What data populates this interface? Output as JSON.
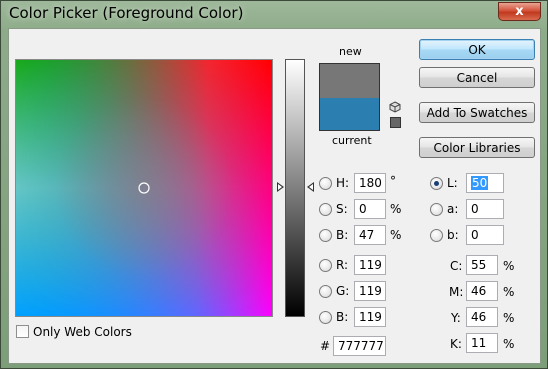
{
  "window": {
    "title": "Color Picker (Foreground Color)",
    "close_glyph": "x"
  },
  "swatch": {
    "new_label": "new",
    "current_label": "current",
    "new_color": "#777777",
    "current_color": "#2b7fb0"
  },
  "buttons": {
    "ok": "OK",
    "cancel": "Cancel",
    "add_to_swatches": "Add To Swatches",
    "color_libraries": "Color Libraries"
  },
  "hsb": {
    "h": {
      "label": "H:",
      "value": "180",
      "unit": "°"
    },
    "s": {
      "label": "S:",
      "value": "0",
      "unit": "%"
    },
    "b": {
      "label": "B:",
      "value": "47",
      "unit": "%"
    }
  },
  "rgb": {
    "r": {
      "label": "R:",
      "value": "119"
    },
    "g": {
      "label": "G:",
      "value": "119"
    },
    "b": {
      "label": "B:",
      "value": "119"
    }
  },
  "lab": {
    "l": {
      "label": "L:",
      "value": "50"
    },
    "a": {
      "label": "a:",
      "value": "0"
    },
    "b": {
      "label": "b:",
      "value": "0"
    }
  },
  "cmyk": {
    "c": {
      "label": "C:",
      "value": "55",
      "unit": "%"
    },
    "m": {
      "label": "M:",
      "value": "46",
      "unit": "%"
    },
    "y": {
      "label": "Y:",
      "value": "46",
      "unit": "%"
    },
    "k": {
      "label": "K:",
      "value": "11",
      "unit": "%"
    }
  },
  "hex": {
    "label": "#",
    "value": "777777"
  },
  "only_web_colors": {
    "label": "Only Web Colors",
    "checked": false
  },
  "selected_mode": "L"
}
